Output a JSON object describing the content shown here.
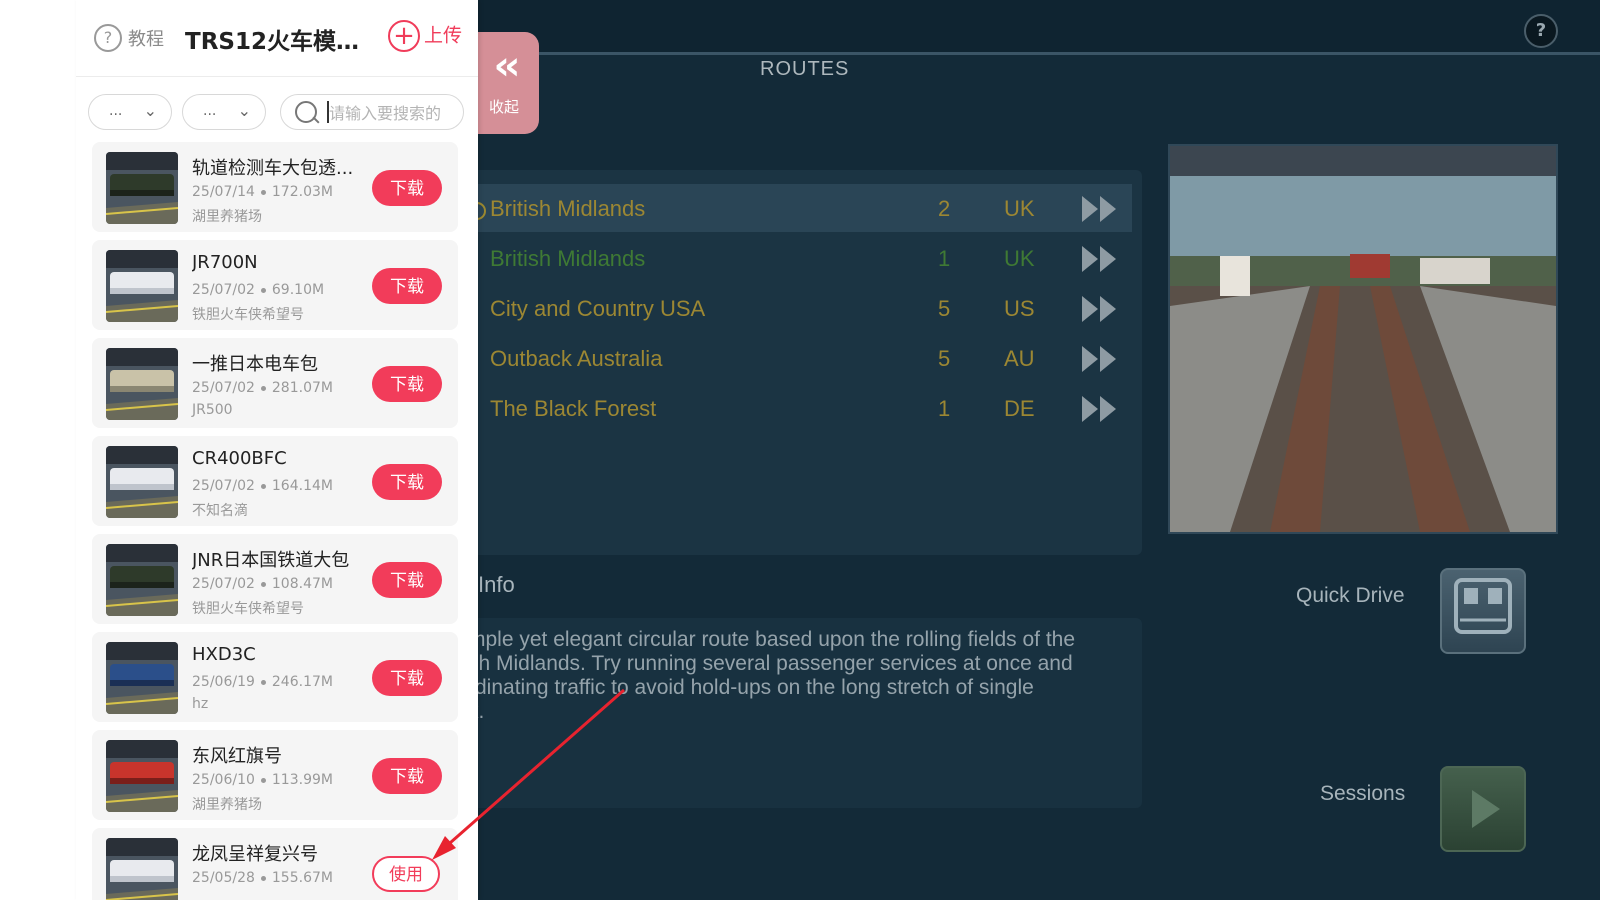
{
  "panel": {
    "tutorial_label": "教程",
    "title": "TRS12火车模拟...",
    "upload_label": "上传",
    "filter1": "...",
    "filter2": "...",
    "search_placeholder": "请输入要搜索的",
    "items": [
      {
        "name": "轨道检测车大包透...",
        "date": "25/07/14",
        "size": "172.03M",
        "author": "湖里养猪场",
        "action": "下载",
        "thumb": "dark"
      },
      {
        "name": "JR700N",
        "date": "25/07/02",
        "size": "69.10M",
        "author": "铁胆火车侠希望号",
        "action": "下载",
        "thumb": "white"
      },
      {
        "name": "一推日本电车包",
        "date": "25/07/02",
        "size": "281.07M",
        "author": "JR500",
        "action": "下载",
        "thumb": "silver"
      },
      {
        "name": "CR400BFC",
        "date": "25/07/02",
        "size": "164.14M",
        "author": "不知名滴",
        "action": "下载",
        "thumb": "white"
      },
      {
        "name": "JNR日本国铁道大包",
        "date": "25/07/02",
        "size": "108.47M",
        "author": "铁胆火车侠希望号",
        "action": "下载",
        "thumb": "dark"
      },
      {
        "name": "HXD3C",
        "date": "25/06/19",
        "size": "246.17M",
        "author": "hz",
        "action": "下载",
        "thumb": "blue"
      },
      {
        "name": "东风红旗号",
        "date": "25/06/10",
        "size": "113.99M",
        "author": "湖里养猪场",
        "action": "下载",
        "thumb": "red"
      },
      {
        "name": "龙凤呈祥复兴号",
        "date": "25/05/28",
        "size": "155.67M",
        "author": "",
        "action": "使用",
        "thumb": "white"
      }
    ]
  },
  "collapse": {
    "label": "收起"
  },
  "game": {
    "routes_title": "ROUTES",
    "routes": [
      {
        "name": "British Midlands",
        "difficulty": "2",
        "country": "UK",
        "color": "#9c8733",
        "selected": true
      },
      {
        "name": "British Midlands",
        "difficulty": "1",
        "country": "UK",
        "color": "#3f7a34",
        "selected": false
      },
      {
        "name": "City and Country USA",
        "difficulty": "5",
        "country": "US",
        "color": "#9c8733",
        "selected": false
      },
      {
        "name": "Outback Australia",
        "difficulty": "5",
        "country": "AU",
        "color": "#9c8733",
        "selected": false
      },
      {
        "name": "The Black Forest",
        "difficulty": "1",
        "country": "DE",
        "color": "#9c8733",
        "selected": false
      }
    ],
    "info_label": "Info",
    "info_text": "mple yet elegant circular route based upon the rolling fields of the\nsh Midlands. Try running several passenger services at once and\nrdinating traffic to avoid hold-ups on the long stretch of single\nk.",
    "quick_drive_label": "Quick Drive",
    "sessions_label": "Sessions",
    "help_symbol": "?"
  },
  "colors": {
    "accent": "#f23c5a",
    "collapse_bg": "#d58f97",
    "game_bg": "#132a38"
  }
}
